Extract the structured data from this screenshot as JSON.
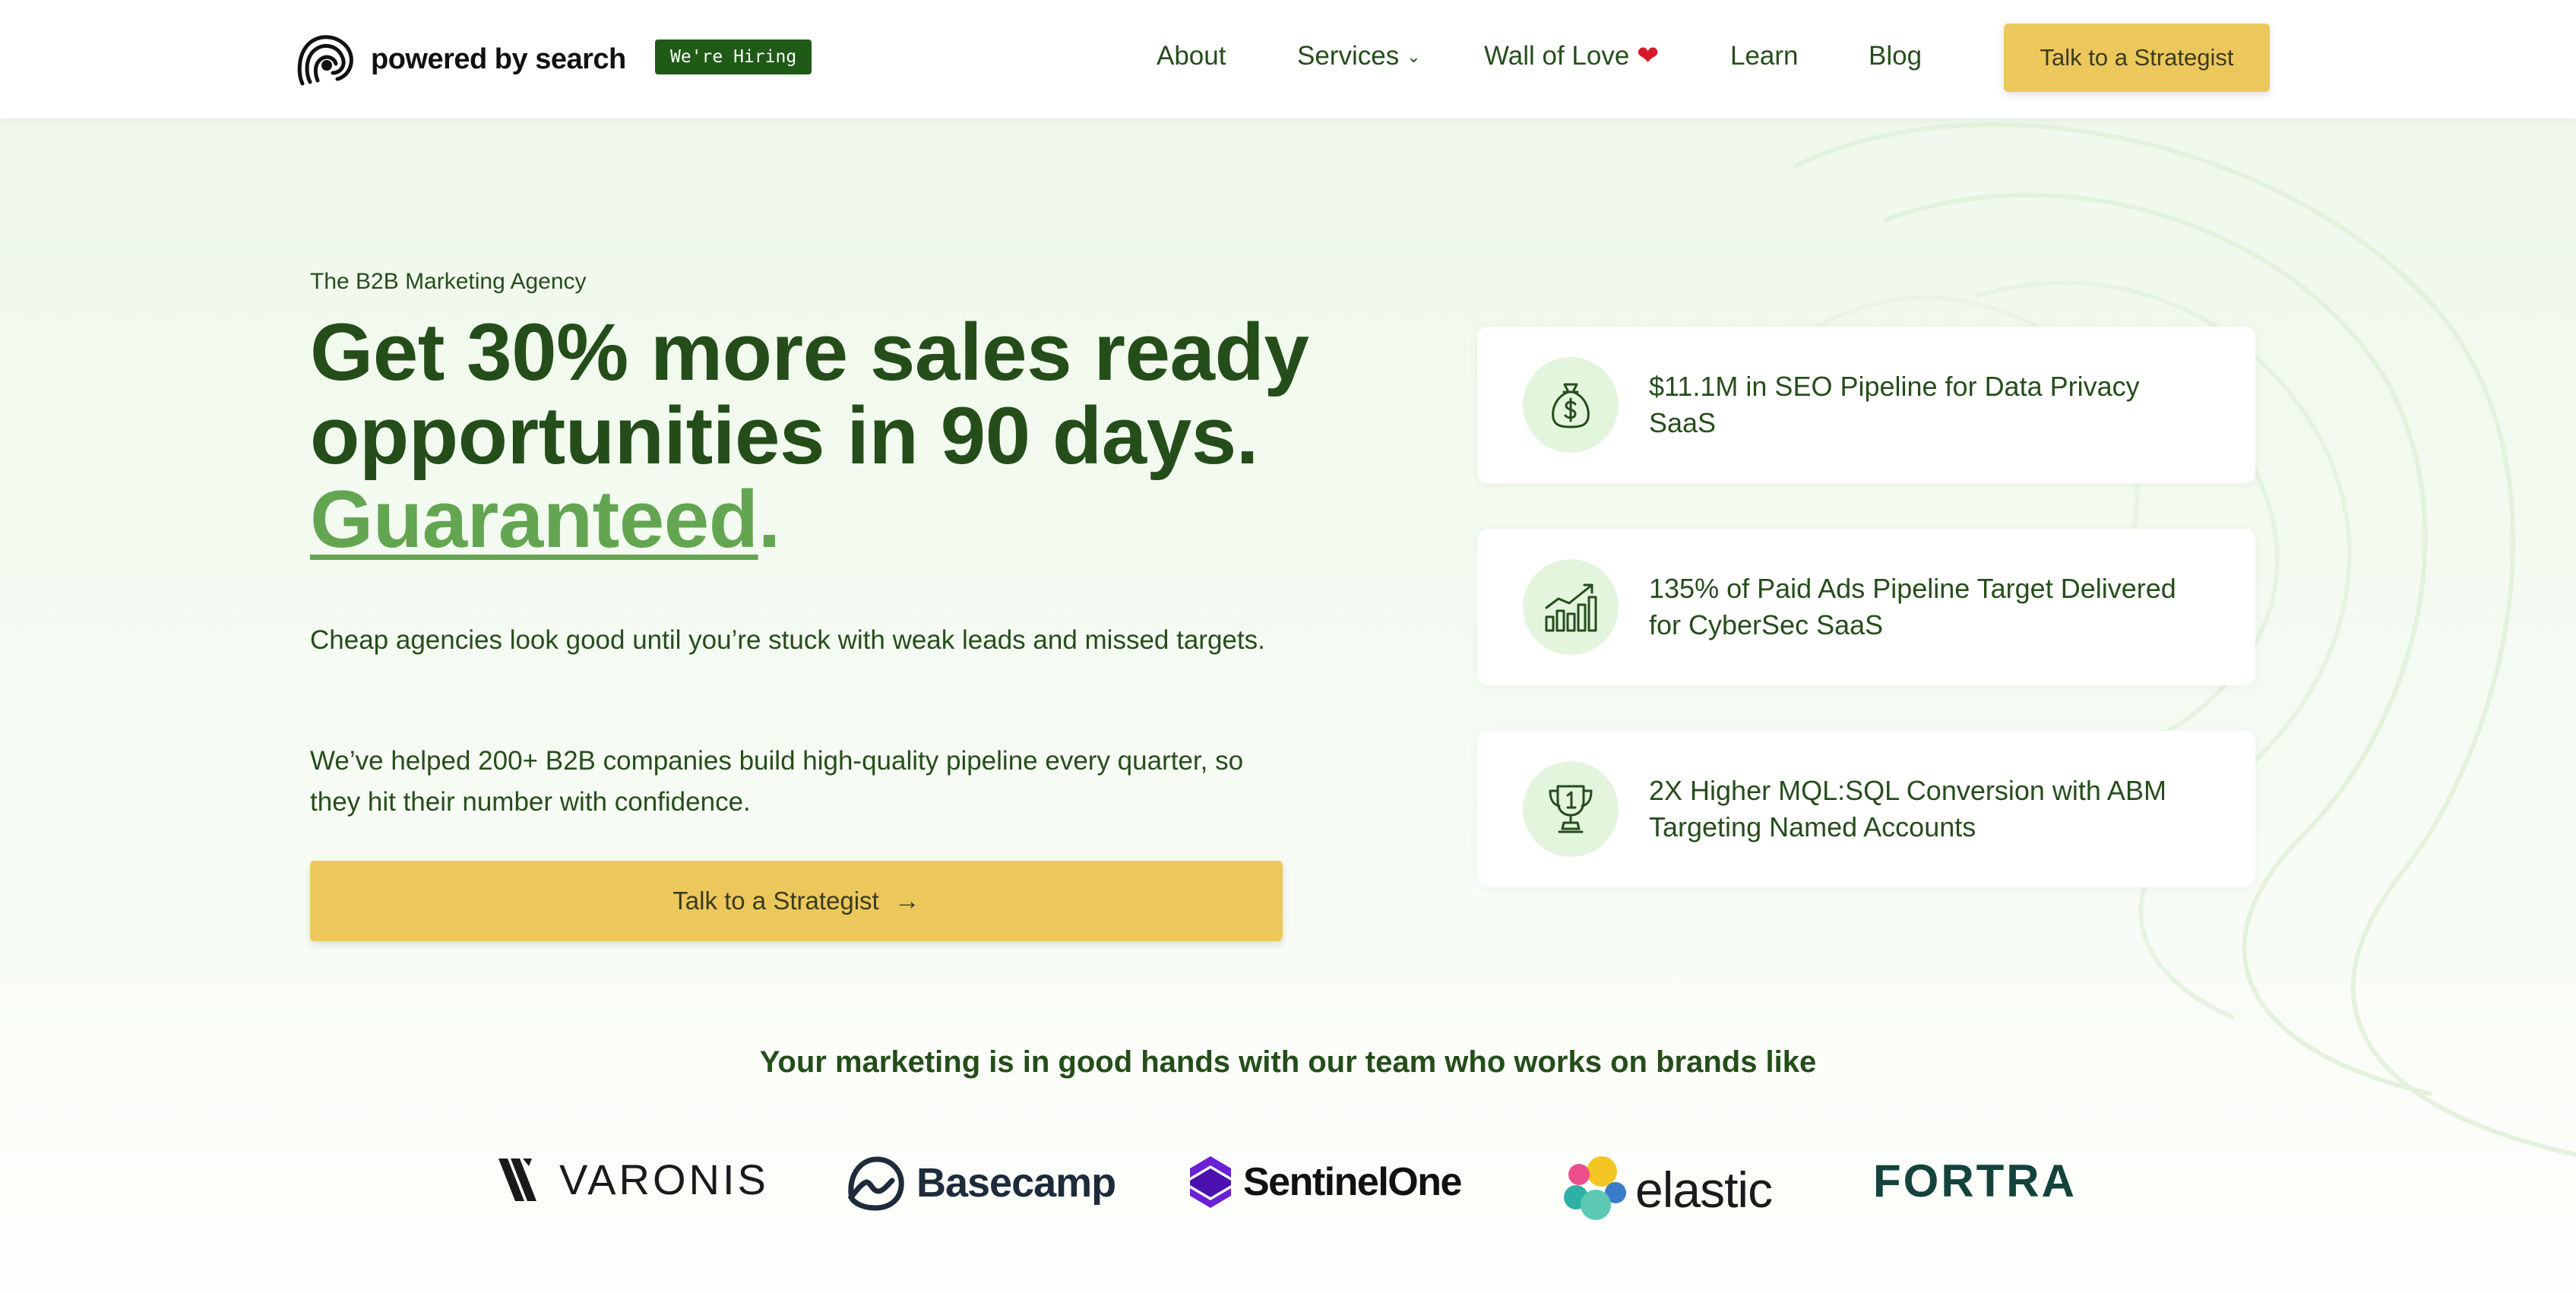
{
  "header": {
    "logo_text": "powered by search",
    "hiring_badge": "We're Hiring",
    "nav": {
      "about": "About",
      "services": "Services",
      "wall_of_love": "Wall of Love",
      "learn": "Learn",
      "blog": "Blog"
    },
    "cta": "Talk to a Strategist"
  },
  "hero": {
    "eyebrow": "The B2B Marketing Agency",
    "headline_line1": "Get 30% more sales ready",
    "headline_line2": "opportunities in 90 days.",
    "headline_accent": "Guaranteed",
    "headline_period": ".",
    "para1": "Cheap agencies look good until you’re stuck with weak leads and missed targets.",
    "para2": "We’ve helped 200+ B2B companies build high-quality pipeline every quarter, so they hit their number with confidence.",
    "cta": "Talk to a Strategist"
  },
  "stats": [
    {
      "icon": "money-bag-icon",
      "text": "$11.1M in SEO Pipeline for Data Privacy SaaS"
    },
    {
      "icon": "growth-chart-icon",
      "text": "135% of Paid Ads Pipeline Target Delivered for CyberSec SaaS"
    },
    {
      "icon": "trophy-icon",
      "text": "2X Higher MQL:SQL Conversion with ABM Targeting Named Accounts"
    }
  ],
  "brands": {
    "title": "Your marketing is in good hands with our team who works on brands like",
    "logos": [
      "VARONIS",
      "Basecamp",
      "SentinelOne",
      "elastic",
      "FORTRA"
    ]
  },
  "colors": {
    "primary_green": "#244d1a",
    "accent_green": "#64a552",
    "cta_yellow": "#ecc85c",
    "badge_green": "#1f5a16",
    "icon_circle": "#e4f5de"
  }
}
